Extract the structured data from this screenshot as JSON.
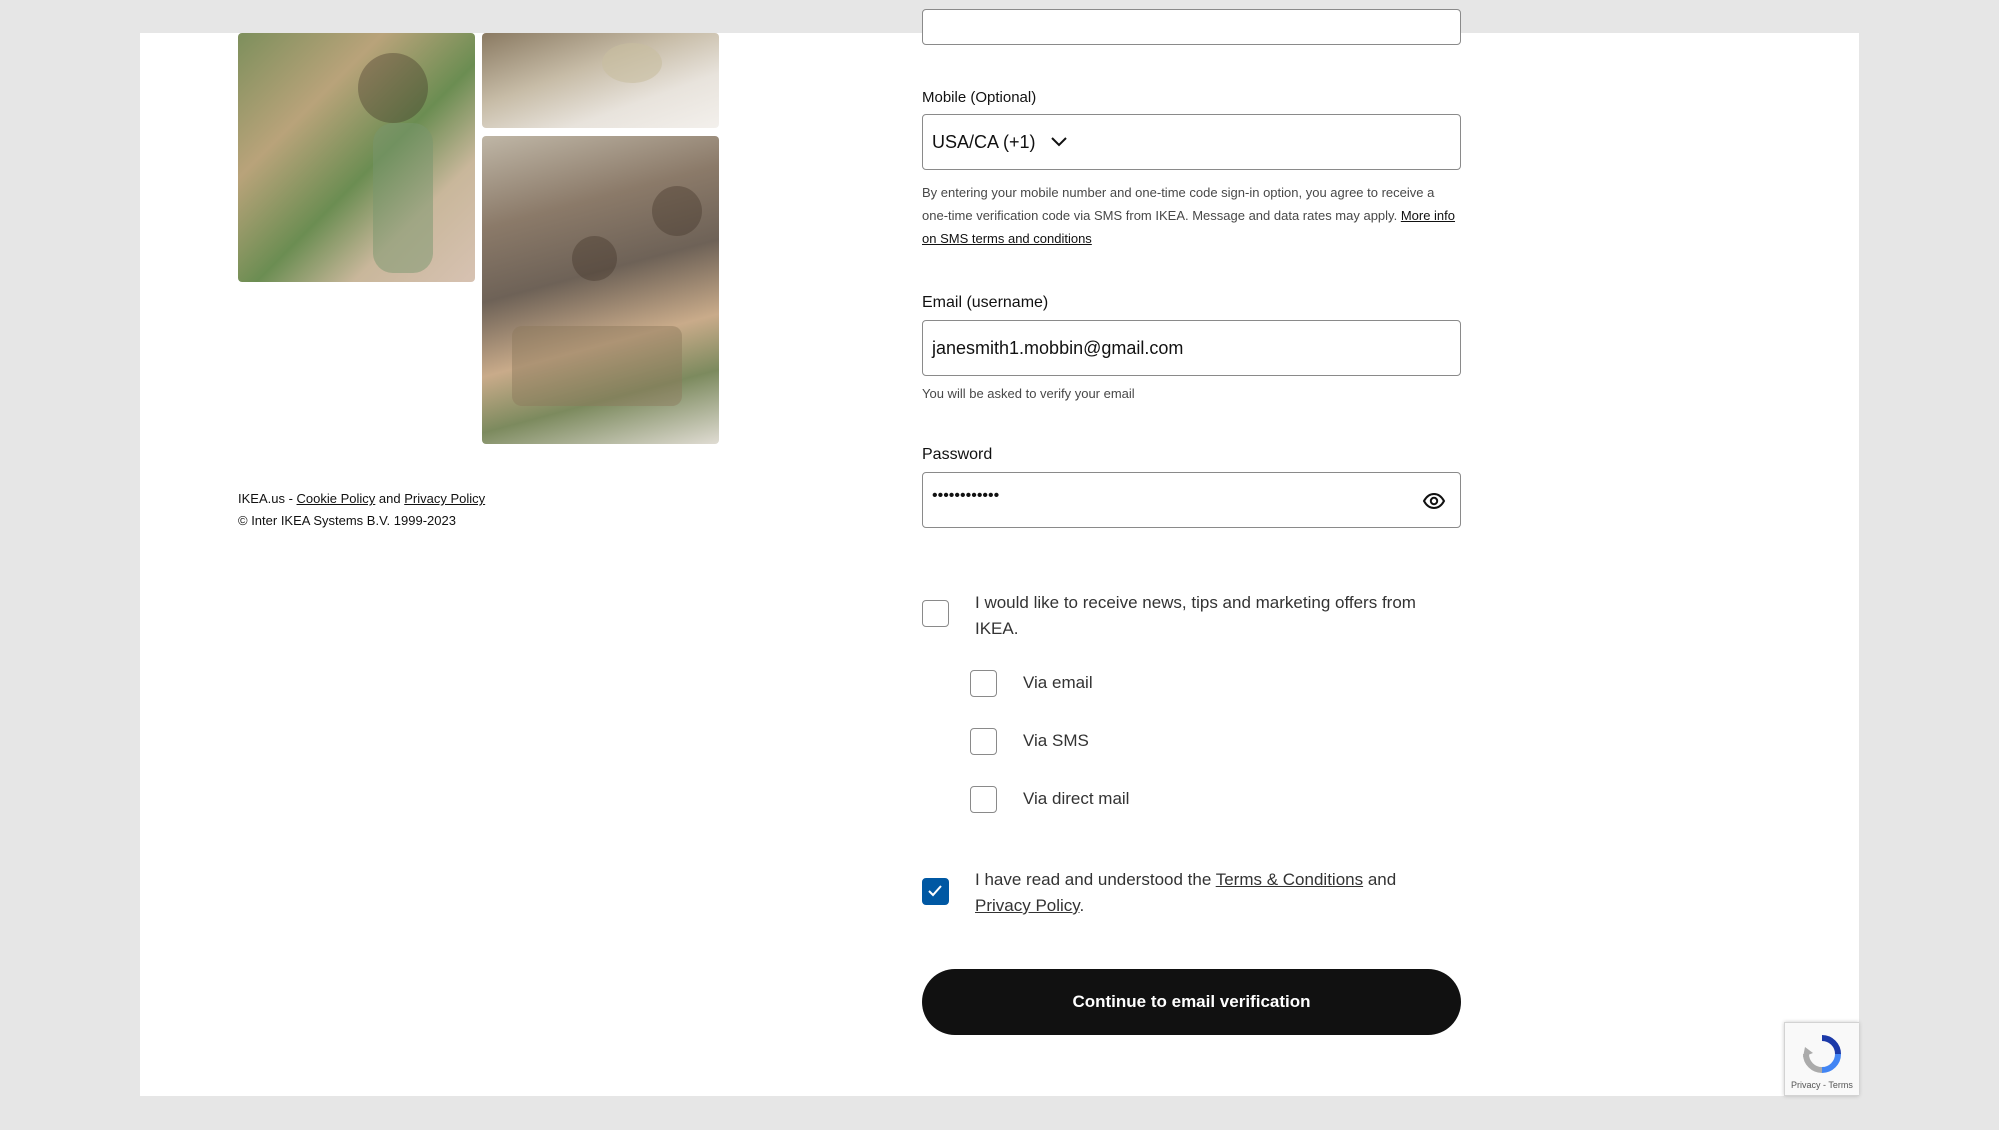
{
  "footer": {
    "site": "IKEA.us - ",
    "cookie_link": "Cookie Policy",
    "and": " and ",
    "privacy_link": "Privacy Policy",
    "copyright": "© Inter IKEA Systems B.V. 1999-2023"
  },
  "mobile": {
    "label": "Mobile (Optional)",
    "country_code": "USA/CA (+1)",
    "disclaimer": "By entering your mobile number and one-time code sign-in option, you agree to receive a one-time verification code via SMS from IKEA. Message and data rates may apply. ",
    "sms_link": "More info on SMS terms and conditions"
  },
  "email": {
    "label": "Email (username)",
    "value": "janesmith1.mobbin@gmail.com",
    "hint": "You will be asked to verify your email"
  },
  "password": {
    "label": "Password",
    "value": "••••••••••••"
  },
  "marketing": {
    "label": "I would like to receive news, tips and marketing offers from IKEA.",
    "checked": false,
    "options": [
      {
        "label": "Via email",
        "checked": false
      },
      {
        "label": "Via SMS",
        "checked": false
      },
      {
        "label": "Via direct mail",
        "checked": false
      }
    ]
  },
  "terms": {
    "prefix": "I have read and understood the ",
    "terms_link": "Terms & Conditions",
    "middle": " and",
    "privacy_link": "Privacy Policy",
    "suffix": ".",
    "checked": true
  },
  "cta_label": "Continue to email verification",
  "recaptcha": {
    "links": "Privacy - Terms"
  },
  "colors": {
    "accent": "#0058a3",
    "cta": "#111111"
  }
}
